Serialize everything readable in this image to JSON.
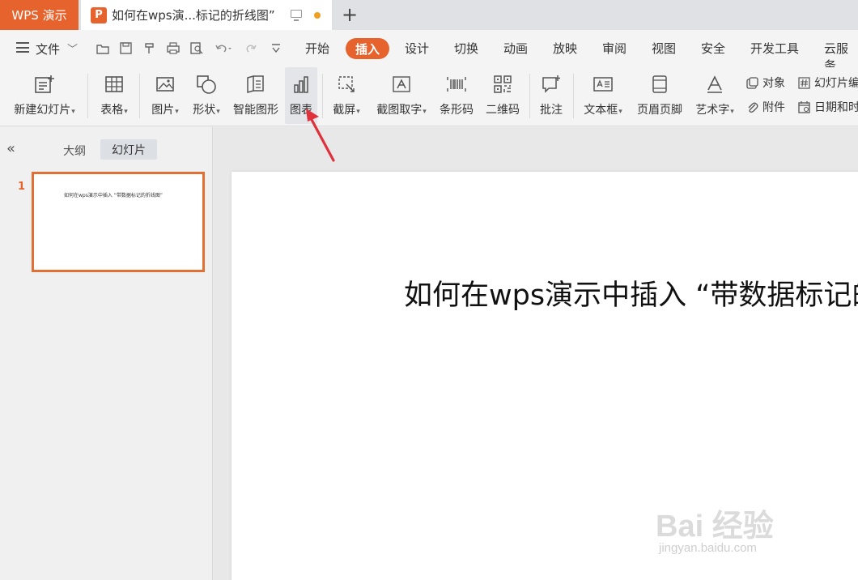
{
  "titlebar": {
    "app_name": "WPS 演示",
    "doc_icon_letter": "P",
    "doc_title": "如何在wps演...标记的折线图”",
    "new_tab_symbol": "+"
  },
  "menubar": {
    "file_label": "文件",
    "file_chevron": "﹀",
    "quick_access_icons": [
      "open-folder-icon",
      "save-icon",
      "format-painter-icon",
      "print-icon",
      "print-preview-icon",
      "undo-icon",
      "redo-icon",
      "more-icon"
    ],
    "tabs": [
      {
        "label": "开始"
      },
      {
        "label": "插入",
        "active": true
      },
      {
        "label": "设计"
      },
      {
        "label": "切换"
      },
      {
        "label": "动画"
      },
      {
        "label": "放映"
      },
      {
        "label": "审阅"
      },
      {
        "label": "视图"
      },
      {
        "label": "安全"
      },
      {
        "label": "开发工具"
      },
      {
        "label": "云服务"
      }
    ],
    "accent_color": "#e7632d"
  },
  "ribbon": {
    "new_slide": "新建幻灯片",
    "table": "表格",
    "picture": "图片",
    "shape": "形状",
    "smart_art": "智能图形",
    "chart": "图表",
    "screenshot": "截屏",
    "ocr": "截图取字",
    "barcode": "条形码",
    "qrcode": "二维码",
    "comment": "批注",
    "textbox": "文本框",
    "header_footer": "页眉页脚",
    "word_art": "艺术字",
    "object": "对象",
    "attachment": "附件",
    "slide_number": "幻灯片编",
    "datetime": "日期和时"
  },
  "leftpane": {
    "collapse_symbol": "«",
    "tab_outline": "大纲",
    "tab_slides": "幻灯片",
    "slide_number": "1",
    "thumb_text": "如何在wps演示中插入 “带数据标记的折线图”"
  },
  "slide": {
    "title": "如何在wps演示中插入 “带数据标记的折线图”"
  },
  "watermark": {
    "brand": "Bai 经验",
    "url": "jingyan.baidu.com"
  }
}
